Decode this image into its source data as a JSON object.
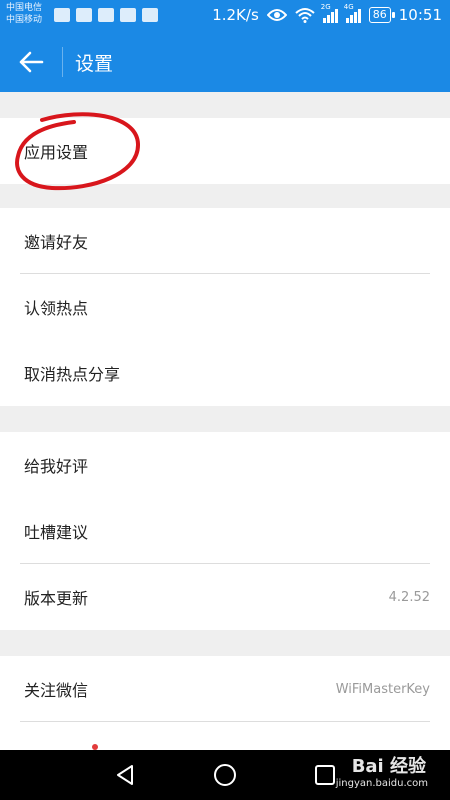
{
  "status_bar": {
    "carrier_1": "中国电信",
    "carrier_2": "中国移动",
    "speed": "1.2K/s",
    "signal_1_label": "2G",
    "signal_2_label": "4G",
    "battery": "86",
    "time": "10:51"
  },
  "app_bar": {
    "title": "设置",
    "back_icon": "arrow-left-icon"
  },
  "sections": [
    {
      "items": [
        {
          "label": "应用设置",
          "value": ""
        }
      ]
    },
    {
      "items": [
        {
          "label": "邀请好友",
          "value": ""
        },
        {
          "label": "认领热点",
          "value": ""
        },
        {
          "label": "取消热点分享",
          "value": ""
        }
      ]
    },
    {
      "items": [
        {
          "label": "给我好评",
          "value": ""
        },
        {
          "label": "吐槽建议",
          "value": ""
        },
        {
          "label": "版本更新",
          "value": "4.2.52"
        }
      ]
    },
    {
      "items": [
        {
          "label": "关注微信",
          "value": "WiFiMasterKey"
        }
      ]
    }
  ],
  "watermark": {
    "text": "Bai 经验",
    "url": "jingyan.baidu.com"
  },
  "colors": {
    "primary": "#1b89e5",
    "annotation_circle": "#d8161c"
  }
}
